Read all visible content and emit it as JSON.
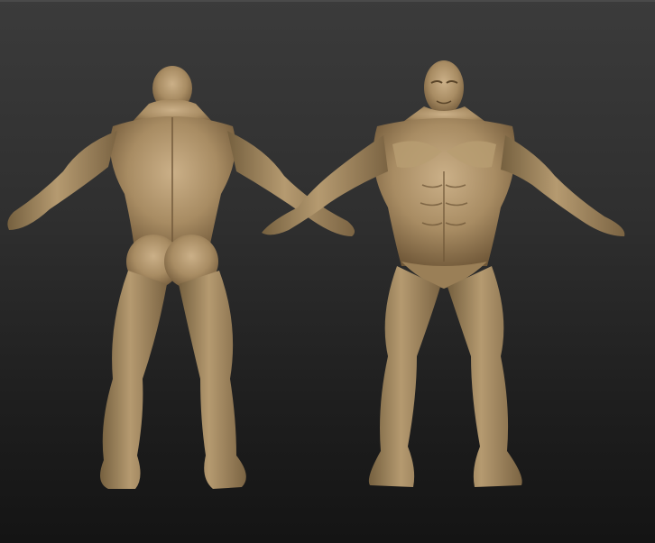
{
  "viewport": {
    "background_top": "#3b3b3b",
    "background_bottom": "#141414"
  },
  "model": {
    "material_color": "#a88c63",
    "shadow_color": "#6e5637",
    "highlight_color": "#d2b88d",
    "views": [
      "back-view",
      "front-view"
    ]
  }
}
